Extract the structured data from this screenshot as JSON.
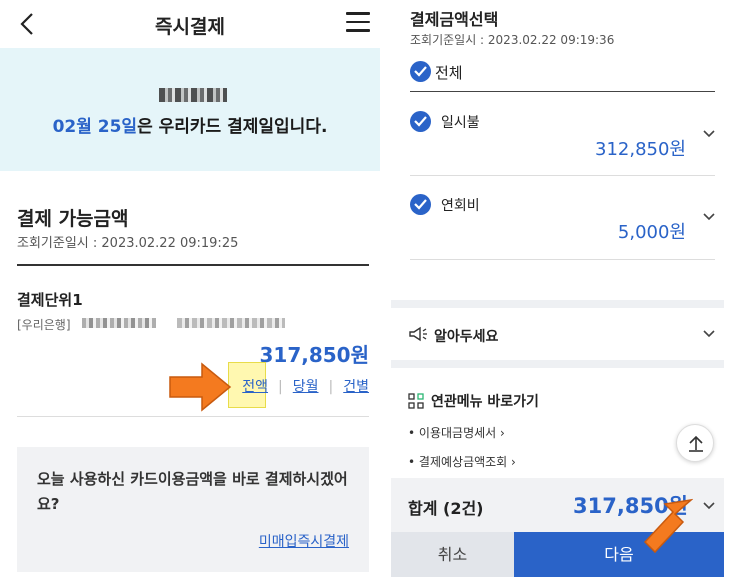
{
  "left": {
    "header": {
      "title": "즉시결제"
    },
    "banner": {
      "date": "02월 25일",
      "text_suffix": "은 우리카드 결제일입니다."
    },
    "section": {
      "title": "결제 가능금액",
      "timestamp": "조회기준일시 : 2023.02.22 09:19:25"
    },
    "unit": {
      "title": "결제단위1",
      "bank": "[우리은행]",
      "amount": "317,850원"
    },
    "options": {
      "full": "전액",
      "month": "당월",
      "item": "건별"
    },
    "promo": {
      "text": "오늘 사용하신 카드이용금액을 바로 결제하시겠어요?",
      "link": "미매입즉시결제"
    }
  },
  "right": {
    "title": "결제금액선택",
    "timestamp": "조회기준일시 : 2023.02.22 09:19:36",
    "select_all": "전체",
    "items": [
      {
        "label": "일시불",
        "amount": "312,850원"
      },
      {
        "label": "연회비",
        "amount": "5,000원"
      }
    ],
    "notice": "알아두세요",
    "related": {
      "title": "연관메뉴 바로가기",
      "links": [
        "이용대금명세서",
        "결제예상금액조회"
      ]
    },
    "total": {
      "label": "합계 (2건)",
      "amount": "317,850원"
    },
    "buttons": {
      "cancel": "취소",
      "next": "다음"
    }
  },
  "colors": {
    "accent": "#2a63c8",
    "banner_bg": "#e5f5f9",
    "arrow": "#f47a1f"
  }
}
